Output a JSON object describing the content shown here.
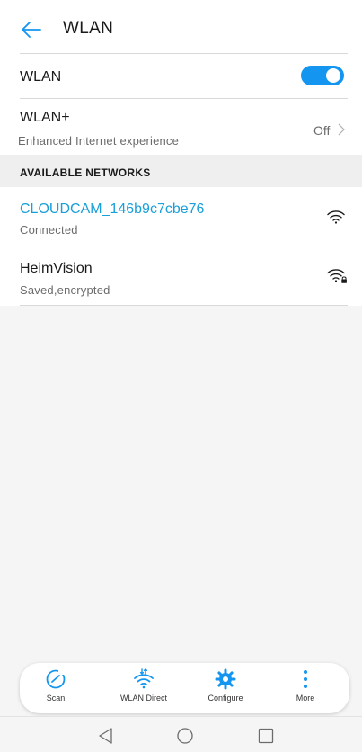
{
  "header": {
    "title": "WLAN"
  },
  "wlan_row": {
    "label": "WLAN",
    "enabled": true
  },
  "wlan_plus": {
    "label": "WLAN+",
    "subtitle": "Enhanced Internet experience",
    "value": "Off"
  },
  "section": {
    "title": "AVAILABLE NETWORKS"
  },
  "networks": [
    {
      "name": "CLOUDCAM_146b9c7cbe76",
      "status": "Connected",
      "icon": "wifi-icon"
    },
    {
      "name": "HeimVision",
      "status": "Saved,encrypted",
      "icon": "wifi-lock-icon"
    }
  ],
  "bottom_bar": [
    {
      "label": "Scan",
      "icon": "scan-icon"
    },
    {
      "label": "WLAN Direct",
      "icon": "wlan-direct-icon"
    },
    {
      "label": "Configure",
      "icon": "gear-icon"
    },
    {
      "label": "More",
      "icon": "more-icon"
    }
  ],
  "colors": {
    "accent": "#1496f0",
    "connected_text": "#1a9fd9"
  }
}
